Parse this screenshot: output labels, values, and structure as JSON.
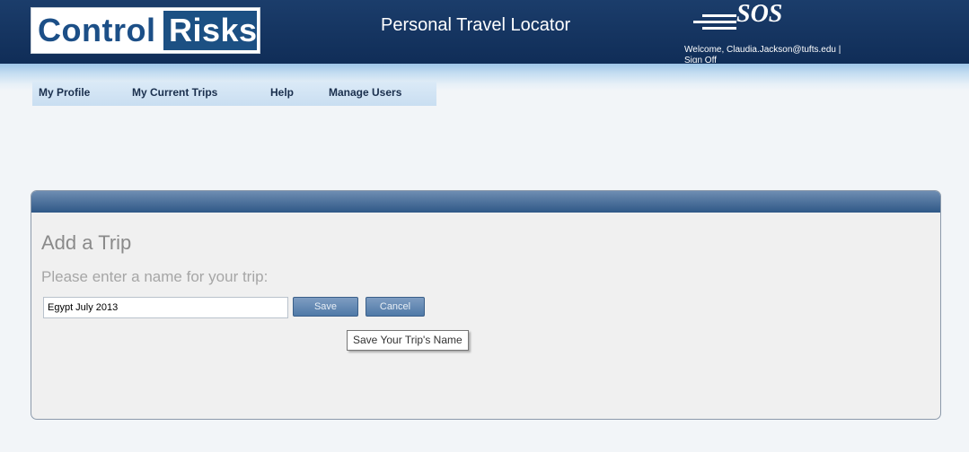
{
  "header": {
    "logo_word1": "Control",
    "logo_word2": "Risks",
    "app_title": "Personal Travel Locator",
    "sos_logo_text": "SOS",
    "welcome_text": "Welcome, Claudia.Jackson@tufts.edu |",
    "sign_off_label": "Sign Off"
  },
  "nav": {
    "items": [
      {
        "label": "My Profile"
      },
      {
        "label": "My Current Trips"
      },
      {
        "label": "Help"
      },
      {
        "label": "Manage Users"
      }
    ]
  },
  "panel": {
    "title": "Add a Trip",
    "prompt": "Please enter a name for your trip:",
    "trip_name_value": "Egypt July 2013",
    "save_label": "Save",
    "cancel_label": "Cancel",
    "tooltip": "Save Your Trip's Name"
  },
  "colors": {
    "header_bg": "#133463",
    "accent_blue": "#1c5083",
    "button_blue": "#5f85b1",
    "page_bg": "#f2f5f8"
  }
}
